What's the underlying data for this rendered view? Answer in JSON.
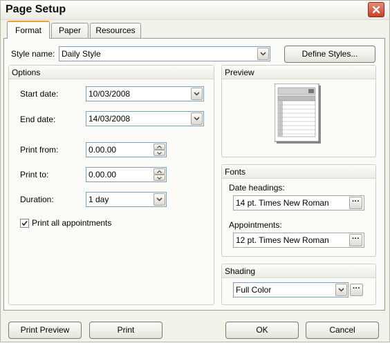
{
  "window": {
    "title": "Page Setup"
  },
  "tabs": [
    {
      "label": "Format",
      "active": true
    },
    {
      "label": "Paper",
      "active": false
    },
    {
      "label": "Resources",
      "active": false
    }
  ],
  "style": {
    "label": "Style name:",
    "value": "Daily Style",
    "define_button": "Define Styles..."
  },
  "options": {
    "header": "Options",
    "start_date": {
      "label": "Start date:",
      "value": "10/03/2008"
    },
    "end_date": {
      "label": "End date:",
      "value": "14/03/2008"
    },
    "print_from": {
      "label": "Print from:",
      "value": "0.00.00"
    },
    "print_to": {
      "label": "Print to:",
      "value": "0.00.00"
    },
    "duration": {
      "label": "Duration:",
      "value": "1 day"
    },
    "print_all": {
      "label": "Print all appointments",
      "checked": true
    }
  },
  "preview": {
    "header": "Preview"
  },
  "fonts": {
    "header": "Fonts",
    "date_headings": {
      "label": "Date headings:",
      "value": "14 pt. Times New Roman"
    },
    "appointments": {
      "label": "Appointments:",
      "value": "12 pt. Times New Roman"
    }
  },
  "shading": {
    "header": "Shading",
    "value": "Full Color"
  },
  "buttons": {
    "print_preview": "Print Preview",
    "print": "Print",
    "ok": "OK",
    "cancel": "Cancel"
  },
  "colors": {
    "close_button": "#c8412a",
    "active_tab_accent": "#f0a030",
    "field_border": "#7f9db9"
  }
}
